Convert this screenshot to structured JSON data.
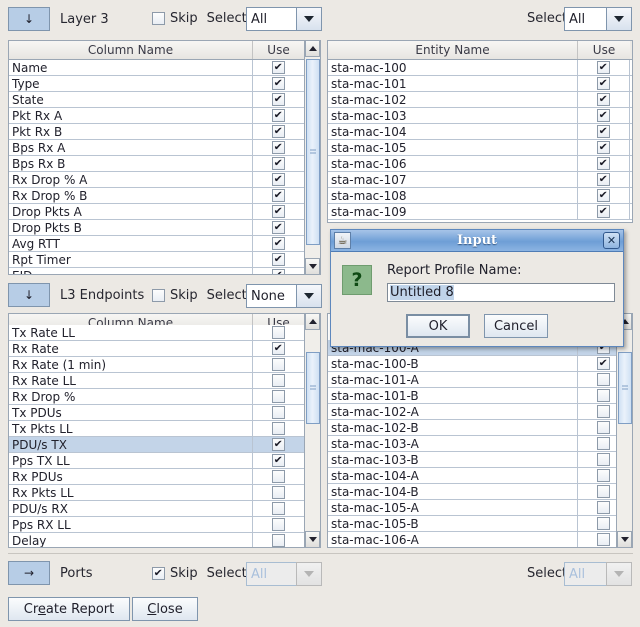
{
  "window": {
    "background": "#ece9e4"
  },
  "sections": [
    {
      "id": "layer3",
      "arrow": "↓",
      "label": "Layer 3",
      "skip_label": "Skip",
      "skip_checked": false,
      "select_label": "Select",
      "select_value": "All",
      "select_disabled": false,
      "right_select_label": "Select",
      "right_select_value": "All",
      "right_select_disabled": false,
      "left_header": [
        "Column Name",
        "Use"
      ],
      "right_header": [
        "Entity Name",
        "Use"
      ],
      "left_rows": [
        {
          "name": "Name",
          "use": true,
          "selected": false
        },
        {
          "name": "Type",
          "use": true,
          "selected": false
        },
        {
          "name": "State",
          "use": true,
          "selected": false
        },
        {
          "name": "Pkt Rx A",
          "use": true,
          "selected": false
        },
        {
          "name": "Pkt Rx B",
          "use": true,
          "selected": false
        },
        {
          "name": "Bps Rx A",
          "use": true,
          "selected": false
        },
        {
          "name": "Bps Rx B",
          "use": true,
          "selected": false
        },
        {
          "name": "Rx Drop % A",
          "use": true,
          "selected": false
        },
        {
          "name": "Rx Drop % B",
          "use": true,
          "selected": false
        },
        {
          "name": "Drop Pkts A",
          "use": true,
          "selected": false
        },
        {
          "name": "Drop Pkts B",
          "use": true,
          "selected": false
        },
        {
          "name": "Avg RTT",
          "use": true,
          "selected": false
        },
        {
          "name": "Rpt Timer",
          "use": true,
          "selected": false
        },
        {
          "name": "EID",
          "use": true,
          "selected": false
        }
      ],
      "right_rows": [
        {
          "name": "sta-mac-100",
          "use": true,
          "selected": false
        },
        {
          "name": "sta-mac-101",
          "use": true,
          "selected": false
        },
        {
          "name": "sta-mac-102",
          "use": true,
          "selected": false
        },
        {
          "name": "sta-mac-103",
          "use": true,
          "selected": false
        },
        {
          "name": "sta-mac-104",
          "use": true,
          "selected": false
        },
        {
          "name": "sta-mac-105",
          "use": true,
          "selected": false
        },
        {
          "name": "sta-mac-106",
          "use": true,
          "selected": false
        },
        {
          "name": "sta-mac-107",
          "use": true,
          "selected": false
        },
        {
          "name": "sta-mac-108",
          "use": true,
          "selected": false
        },
        {
          "name": "sta-mac-109",
          "use": true,
          "selected": false
        }
      ]
    },
    {
      "id": "l3endpoints",
      "arrow": "↓",
      "label": "L3 Endpoints",
      "skip_label": "Skip",
      "skip_checked": false,
      "select_label": "Select",
      "select_value": "None",
      "select_disabled": false,
      "left_header": [
        "Column Name",
        "Use"
      ],
      "left_rows": [
        {
          "name": "Tx Rate LL",
          "use": false,
          "selected": false
        },
        {
          "name": "Rx Rate",
          "use": true,
          "selected": false
        },
        {
          "name": "Rx Rate (1 min)",
          "use": false,
          "selected": false
        },
        {
          "name": "Rx Rate LL",
          "use": false,
          "selected": false
        },
        {
          "name": "Rx Drop %",
          "use": false,
          "selected": false
        },
        {
          "name": "Tx PDUs",
          "use": false,
          "selected": false
        },
        {
          "name": "Tx Pkts LL",
          "use": false,
          "selected": false
        },
        {
          "name": "PDU/s TX",
          "use": true,
          "selected": true
        },
        {
          "name": "Pps TX LL",
          "use": true,
          "selected": false
        },
        {
          "name": "Rx PDUs",
          "use": false,
          "selected": false
        },
        {
          "name": "Rx Pkts LL",
          "use": false,
          "selected": false
        },
        {
          "name": "PDU/s RX",
          "use": false,
          "selected": false
        },
        {
          "name": "Pps RX LL",
          "use": false,
          "selected": false
        },
        {
          "name": "Delay",
          "use": false,
          "selected": false
        }
      ],
      "right_rows": [
        {
          "name": "sta-mac-100-A",
          "use": true,
          "selected": true
        },
        {
          "name": "sta-mac-100-B",
          "use": true,
          "selected": false
        },
        {
          "name": "sta-mac-101-A",
          "use": false,
          "selected": false
        },
        {
          "name": "sta-mac-101-B",
          "use": false,
          "selected": false
        },
        {
          "name": "sta-mac-102-A",
          "use": false,
          "selected": false
        },
        {
          "name": "sta-mac-102-B",
          "use": false,
          "selected": false
        },
        {
          "name": "sta-mac-103-A",
          "use": false,
          "selected": false
        },
        {
          "name": "sta-mac-103-B",
          "use": false,
          "selected": false
        },
        {
          "name": "sta-mac-104-A",
          "use": false,
          "selected": false
        },
        {
          "name": "sta-mac-104-B",
          "use": false,
          "selected": false
        },
        {
          "name": "sta-mac-105-A",
          "use": false,
          "selected": false
        },
        {
          "name": "sta-mac-105-B",
          "use": false,
          "selected": false
        },
        {
          "name": "sta-mac-106-A",
          "use": false,
          "selected": false
        }
      ]
    }
  ],
  "ports_section": {
    "arrow": "→",
    "label": "Ports",
    "skip_label": "Skip",
    "skip_checked": true,
    "select_label": "Select",
    "select_value": "All",
    "select_disabled": true,
    "right_select_label": "Select",
    "right_select_value": "All",
    "right_select_disabled": true
  },
  "footer": {
    "create_report": "Create Report",
    "create_report_pre": "Cr",
    "create_report_mnem": "e",
    "create_report_post": "ate Report",
    "close": "Close",
    "close_mnem": "C",
    "close_post": "lose"
  },
  "dialog": {
    "title": "Input",
    "icon": "java-icon",
    "close_icon": "✕",
    "question_icon": "?",
    "label": "Report Profile Name:",
    "input_value": "Untitled 8",
    "input_selected": true,
    "ok_label": "OK",
    "cancel_label": "Cancel"
  },
  "colors": {
    "accent": "#b7cde6",
    "selection": "#c3d4e8",
    "titlebar": "#6e9ed6",
    "question_green": "#8cb98c"
  }
}
